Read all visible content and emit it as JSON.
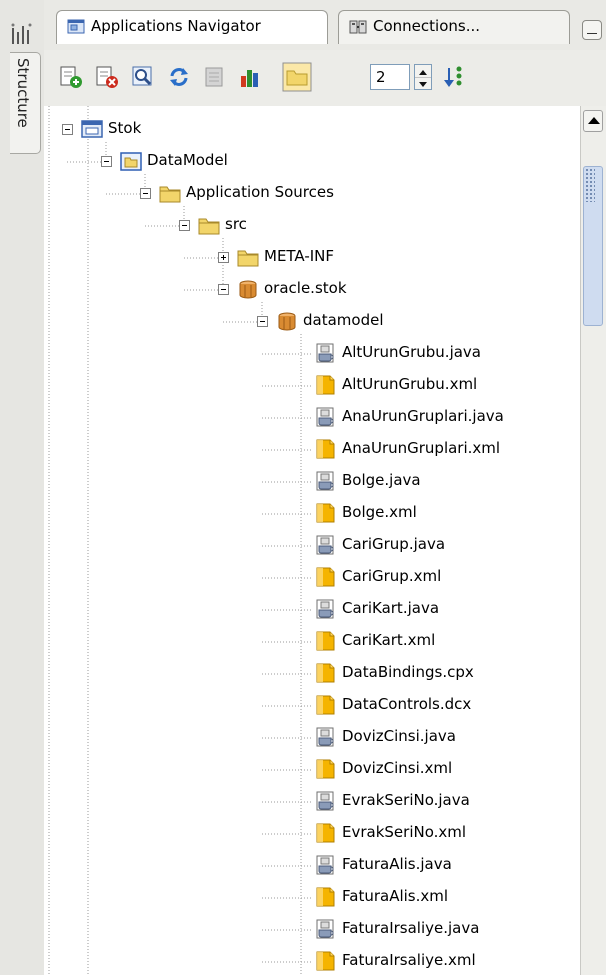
{
  "side_panel": {
    "tab_label": "Structure",
    "tab_icon": "structure-icon"
  },
  "tabs": [
    {
      "label": "Applications Navigator",
      "icon": "applications-navigator-icon",
      "active": true
    },
    {
      "label": "Connections...",
      "icon": "connections-icon",
      "active": false
    }
  ],
  "toolbar": {
    "buttons": [
      {
        "name": "add-button",
        "icon": "add-icon"
      },
      {
        "name": "remove-button",
        "icon": "remove-icon"
      },
      {
        "name": "find-button",
        "icon": "magnifier-icon"
      },
      {
        "name": "refresh-button",
        "icon": "refresh-icon"
      },
      {
        "name": "properties-button",
        "icon": "properties-icon"
      },
      {
        "name": "chart-button",
        "icon": "bar-chart-icon"
      },
      {
        "name": "show-folders-toggle",
        "icon": "folder-icon"
      }
    ],
    "depth_value": "2",
    "sort_icon": "sort-icon"
  },
  "tree": {
    "nodes": [
      {
        "label": "Stok",
        "icon": "project-icon",
        "expanded": true
      },
      {
        "label": "DataModel",
        "icon": "model-folder-icon",
        "expanded": true
      },
      {
        "label": "Application Sources",
        "icon": "folder-icon",
        "expanded": true
      },
      {
        "label": "src",
        "icon": "folder-icon",
        "expanded": true
      },
      {
        "label": "META-INF",
        "icon": "folder-icon",
        "expanded": false
      },
      {
        "label": "oracle.stok",
        "icon": "package-icon",
        "expanded": true
      },
      {
        "label": "datamodel",
        "icon": "package-icon",
        "expanded": true
      },
      {
        "label": "AltUrunGrubu.java",
        "icon": "java-file-icon"
      },
      {
        "label": "AltUrunGrubu.xml",
        "icon": "xml-file-icon"
      },
      {
        "label": "AnaUrunGruplari.java",
        "icon": "java-file-icon"
      },
      {
        "label": "AnaUrunGruplari.xml",
        "icon": "xml-file-icon"
      },
      {
        "label": "Bolge.java",
        "icon": "java-file-icon"
      },
      {
        "label": "Bolge.xml",
        "icon": "xml-file-icon"
      },
      {
        "label": "CariGrup.java",
        "icon": "java-file-icon"
      },
      {
        "label": "CariGrup.xml",
        "icon": "xml-file-icon"
      },
      {
        "label": "CariKart.java",
        "icon": "java-file-icon"
      },
      {
        "label": "CariKart.xml",
        "icon": "xml-file-icon"
      },
      {
        "label": "DataBindings.cpx",
        "icon": "xml-file-icon"
      },
      {
        "label": "DataControls.dcx",
        "icon": "xml-file-icon"
      },
      {
        "label": "DovizCinsi.java",
        "icon": "java-file-icon"
      },
      {
        "label": "DovizCinsi.xml",
        "icon": "xml-file-icon"
      },
      {
        "label": "EvrakSeriNo.java",
        "icon": "java-file-icon"
      },
      {
        "label": "EvrakSeriNo.xml",
        "icon": "xml-file-icon"
      },
      {
        "label": "FaturaAlis.java",
        "icon": "java-file-icon"
      },
      {
        "label": "FaturaAlis.xml",
        "icon": "xml-file-icon"
      },
      {
        "label": "FaturaIrsaliye.java",
        "icon": "java-file-icon"
      },
      {
        "label": "FaturaIrsaliye.xml",
        "icon": "xml-file-icon"
      }
    ]
  },
  "colors": {
    "folder": "#f2d56a",
    "package": "#d98b32",
    "selection_accent": "#2f5fb3",
    "xml_file": "#f5b400"
  }
}
